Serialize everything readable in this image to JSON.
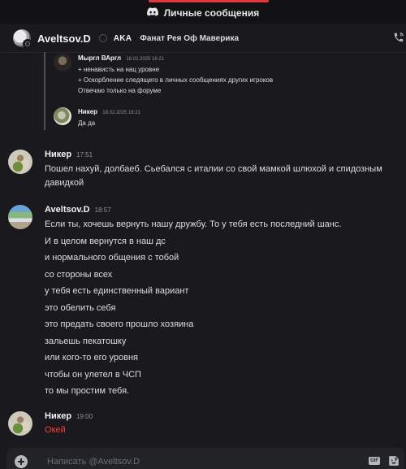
{
  "window": {
    "title": "Личные сообщения",
    "accent_color": "#e0383d"
  },
  "header": {
    "username": "Aveltsov.D",
    "tag": "AKA",
    "status": "Фанат Рея Оф Маверика",
    "icons": [
      "discord-icon",
      "phone-call-icon"
    ]
  },
  "quote": {
    "items": [
      {
        "author": "Мыргл ВАргл",
        "time": "18.02.2025 16:21",
        "lines": [
          "+ ненависть на нац уровне",
          "+ Оскорбление следящего в личных сообщениях других игроков",
          "Отвечаю только на форуме"
        ]
      },
      {
        "author": "Никер",
        "time": "18.02.2025 16:21",
        "lines": [
          "Да да"
        ]
      }
    ]
  },
  "messages": [
    {
      "author": "Никер",
      "time": "17:51",
      "lines": [
        "Пошел нахуй, долбаеб. Сьебался с италии со свой мамкой шлюхой и спидозным давидкой"
      ]
    },
    {
      "author": "Aveltsov.D",
      "time": "18:57",
      "lines": [
        "Если ты, хочешь вернуть нашу дружбу. То у тебя есть последний шанс.",
        "И в целом вернутся в наш дс",
        "и нормального общения с тобой",
        "со стороны всех",
        "у тебя есть единственный вариант",
        "это обелить себя",
        "это предать своего прошло хозяина",
        "зальешь пекатошку",
        "или кого-то его уровня",
        "чтобы он улетел в ЧСП",
        "то мы простим тебя."
      ]
    },
    {
      "author": "Никер",
      "time": "19:00",
      "lines": [
        "Окей"
      ],
      "color": "#f23f43"
    }
  ],
  "composer": {
    "placeholder": "Написать @Aveltsov.D",
    "gif_label": "GIF"
  }
}
